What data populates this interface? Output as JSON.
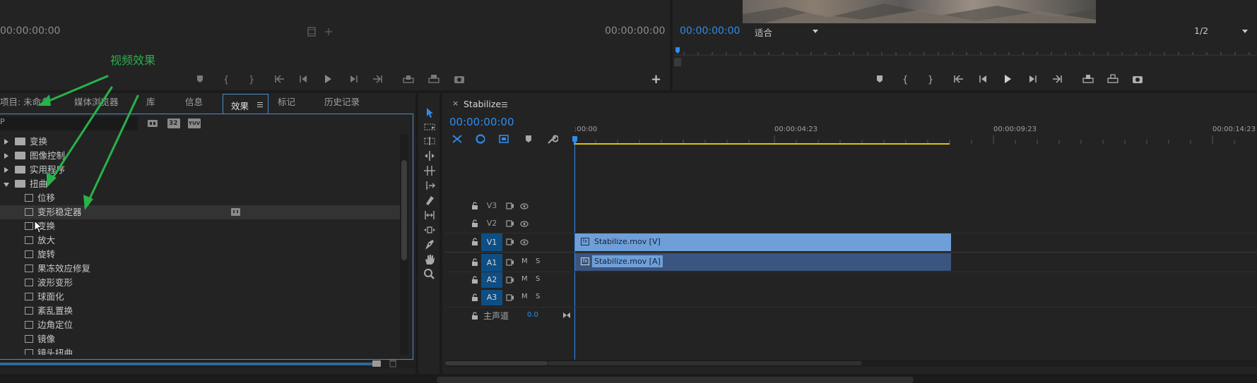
{
  "source_monitor": {
    "timecode_left": "00:00:00:00",
    "timecode_right": "00:00:00:00"
  },
  "program_monitor": {
    "timecode": "00:00:00:00",
    "fit_label": "适合",
    "resolution": "1/2"
  },
  "annotation": {
    "label": "视频效果",
    "color": "#27b24a"
  },
  "project_panel": {
    "tabs": [
      {
        "label": "项目: 未命名"
      },
      {
        "label": "媒体浏览器"
      },
      {
        "label": "库"
      },
      {
        "label": "信息"
      },
      {
        "label": "效果"
      },
      {
        "label": "标记"
      },
      {
        "label": "历史记录"
      }
    ],
    "active_tab": "效果",
    "search_prefix": "P",
    "filter_badges": [
      "32",
      "YUV"
    ],
    "tree": [
      {
        "label": "变换",
        "type": "folder",
        "expanded": false
      },
      {
        "label": "图像控制",
        "type": "folder",
        "expanded": false
      },
      {
        "label": "实用程序",
        "type": "folder",
        "expanded": false
      },
      {
        "label": "扭曲",
        "type": "folder",
        "expanded": true
      },
      {
        "label": "位移",
        "type": "effect"
      },
      {
        "label": "变形稳定器",
        "type": "effect",
        "selected": true
      },
      {
        "label": "变换",
        "type": "effect"
      },
      {
        "label": "放大",
        "type": "effect"
      },
      {
        "label": "旋转",
        "type": "effect"
      },
      {
        "label": "果冻效应修复",
        "type": "effect"
      },
      {
        "label": "波形变形",
        "type": "effect"
      },
      {
        "label": "球面化",
        "type": "effect"
      },
      {
        "label": "紊乱置换",
        "type": "effect"
      },
      {
        "label": "边角定位",
        "type": "effect"
      },
      {
        "label": "镜像",
        "type": "effect"
      },
      {
        "label": "镜头扭曲",
        "type": "effect"
      }
    ]
  },
  "timeline": {
    "sequence_name": "Stabilize",
    "timecode": "00:00:00:00",
    "ruler": [
      ":00:00",
      "00:00:04:23",
      "00:00:09:23",
      "00:00:14:23"
    ],
    "tracks": [
      {
        "name": "V3",
        "kind": "video"
      },
      {
        "name": "V2",
        "kind": "video"
      },
      {
        "name": "V1",
        "kind": "video",
        "on": true
      },
      {
        "name": "A1",
        "kind": "audio",
        "on": true
      },
      {
        "name": "A2",
        "kind": "audio",
        "on": true
      },
      {
        "name": "A3",
        "kind": "audio",
        "on": true
      }
    ],
    "audio_m": "M",
    "audio_s": "S",
    "master_label": "主声道",
    "master_value": "0.0",
    "clips": {
      "video": "Stabilize.mov [V]",
      "audio": "Stabilize.mov [A]"
    },
    "colors": {
      "video_clip": "#6f9fd8",
      "audio_clip": "#3a5580",
      "playhead": "#2d8ceb",
      "work_area": "#d6c414"
    }
  }
}
